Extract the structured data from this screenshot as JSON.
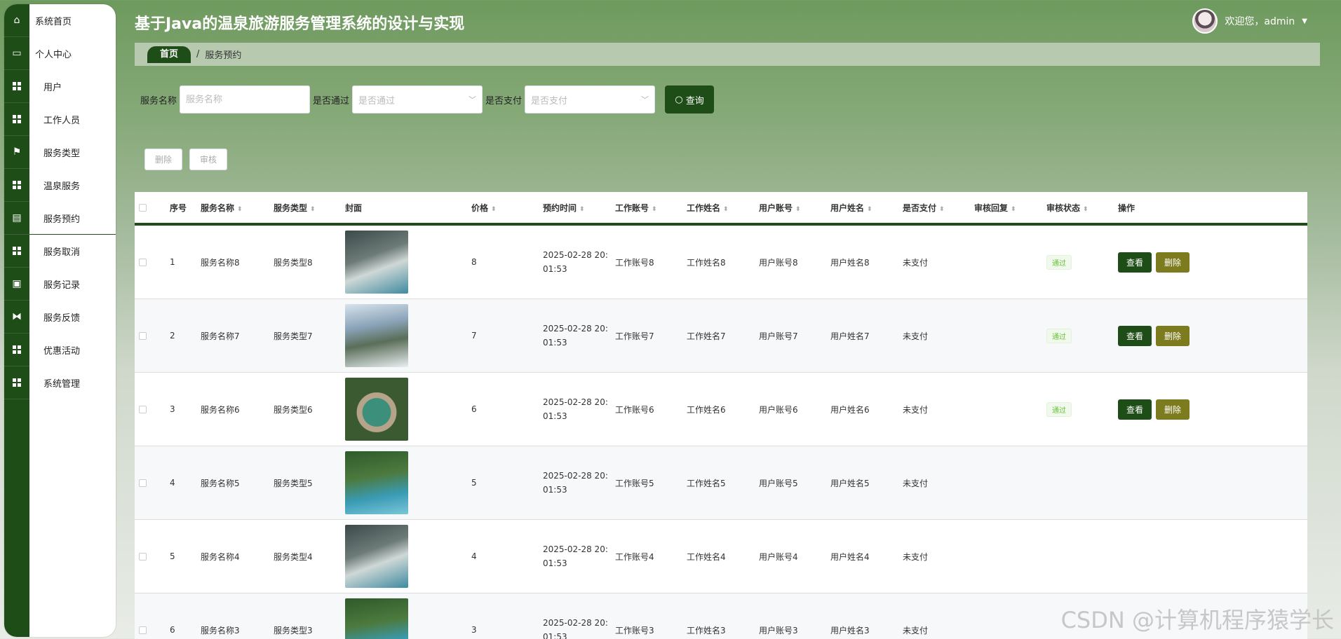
{
  "app": {
    "title": "基于Java的温泉旅游服务管理系统的设计与实现",
    "welcome": "欢迎您，admin"
  },
  "sidebar": {
    "items": [
      {
        "label": "系统首页",
        "icon": "home-icon"
      },
      {
        "label": "个人中心",
        "icon": "card-icon"
      },
      {
        "label": "用户",
        "icon": "grid-icon"
      },
      {
        "label": "工作人员",
        "icon": "grid-icon"
      },
      {
        "label": "服务类型",
        "icon": "flag-icon"
      },
      {
        "label": "温泉服务",
        "icon": "grid-icon"
      },
      {
        "label": "服务预约",
        "icon": "clipboard-icon"
      },
      {
        "label": "服务取消",
        "icon": "grid-icon"
      },
      {
        "label": "服务记录",
        "icon": "printer-icon"
      },
      {
        "label": "服务反馈",
        "icon": "ticket-icon"
      },
      {
        "label": "优惠活动",
        "icon": "grid-icon"
      },
      {
        "label": "系统管理",
        "icon": "grid-icon"
      }
    ]
  },
  "breadcrumb": {
    "home": "首页",
    "separator": "/",
    "current": "服务预约"
  },
  "search": {
    "name_label": "服务名称",
    "name_placeholder": "服务名称",
    "pass_label": "是否通过",
    "pass_placeholder": "是否通过",
    "pay_label": "是否支付",
    "pay_placeholder": "是否支付",
    "button": "查询"
  },
  "actions": {
    "delete": "删除",
    "review": "审核"
  },
  "table": {
    "headers": [
      "序号",
      "服务名称",
      "服务类型",
      "封面",
      "价格",
      "预约时间",
      "工作账号",
      "工作姓名",
      "用户账号",
      "用户姓名",
      "是否支付",
      "审核回复",
      "审核状态",
      "操作"
    ],
    "rows": [
      {
        "idx": "1",
        "name": "服务名称8",
        "type": "服务类型8",
        "price": "8",
        "time1": "2025-02-28 20:",
        "time2": "01:53",
        "wacc": "工作账号8",
        "wname": "工作姓名8",
        "uacc": "用户账号8",
        "uname": "用户姓名8",
        "paid": "未支付",
        "status": "通过",
        "view": "查看",
        "del": "删除"
      },
      {
        "idx": "2",
        "name": "服务名称7",
        "type": "服务类型7",
        "price": "7",
        "time1": "2025-02-28 20:",
        "time2": "01:53",
        "wacc": "工作账号7",
        "wname": "工作姓名7",
        "uacc": "用户账号7",
        "uname": "用户姓名7",
        "paid": "未支付",
        "status": "通过",
        "view": "查看",
        "del": "删除"
      },
      {
        "idx": "3",
        "name": "服务名称6",
        "type": "服务类型6",
        "price": "6",
        "time1": "2025-02-28 20:",
        "time2": "01:53",
        "wacc": "工作账号6",
        "wname": "工作姓名6",
        "uacc": "用户账号6",
        "uname": "用户姓名6",
        "paid": "未支付",
        "status": "通过",
        "view": "查看",
        "del": "删除"
      },
      {
        "idx": "4",
        "name": "服务名称5",
        "type": "服务类型5",
        "price": "5",
        "time1": "2025-02-28 20:",
        "time2": "01:53",
        "wacc": "工作账号5",
        "wname": "工作姓名5",
        "uacc": "用户账号5",
        "uname": "用户姓名5",
        "paid": "未支付"
      },
      {
        "idx": "5",
        "name": "服务名称4",
        "type": "服务类型4",
        "price": "4",
        "time1": "2025-02-28 20:",
        "time2": "01:53",
        "wacc": "工作账号4",
        "wname": "工作姓名4",
        "uacc": "用户账号4",
        "uname": "用户姓名4",
        "paid": "未支付"
      },
      {
        "idx": "6",
        "name": "服务名称3",
        "type": "服务类型3",
        "price": "3",
        "time1": "2025-02-28 20:",
        "time2": "01:53",
        "wacc": "工作账号3",
        "wname": "工作姓名3",
        "uacc": "用户账号3",
        "uname": "用户姓名3",
        "paid": "未支付"
      }
    ]
  },
  "watermark": "CSDN @计算机程序猿学长",
  "colors": {
    "primary": "#1f4d17",
    "delete": "#7c7b1e",
    "tag_green": "#67c23a"
  }
}
